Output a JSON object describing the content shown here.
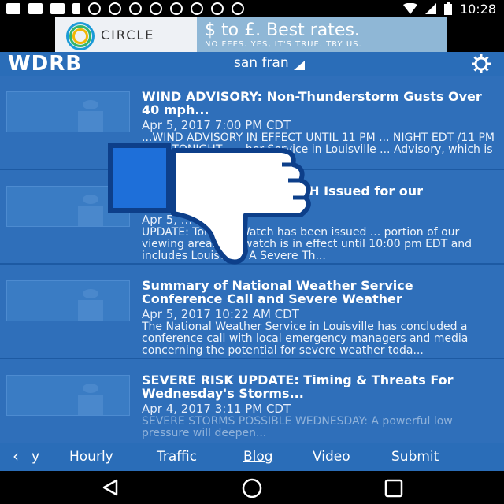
{
  "status_bar": {
    "time": "10:28"
  },
  "ad": {
    "brand": "CIRCLE",
    "headline": "$ to £. Best rates.",
    "subline": "NO FEES. YES, IT'S TRUE. TRY US."
  },
  "header": {
    "logo": "WDRB",
    "location": "san fran"
  },
  "articles": [
    {
      "title": "WIND ADVISORY: Non-Thunderstorm Gusts Over 40 mph...",
      "date": "Apr 5, 2017 7:00 PM CDT",
      "snippet": "...WIND ADVISORY IN EFFECT UNTIL 11 PM ... NIGHT EDT /11 PM CDT/ TONIGHT... ...her Service in Louisville ... Advisory, which is in e..."
    },
    {
      "title": "... and SEVERE ... WATCH Issued for our",
      "date": "Apr 5, ... CDT",
      "snippet": "UPDATE: Tornado Watch has been issued ... portion of our viewing area. The watch is in effect until 10:00 pm EDT and includes Louisville. A Severe Th..."
    },
    {
      "title": "Summary of National Weather Service Conference Call and Severe Weather",
      "date": "Apr 5, 2017 10:22 AM CDT",
      "snippet": "The National Weather Service in Louisville has concluded a conference call with local emergency managers and media concerning the potential for severe weather toda..."
    },
    {
      "title": "SEVERE RISK UPDATE: Timing & Threats For Wednesday's Storms...",
      "date": "Apr 4, 2017 3:11 PM CDT",
      "snippet": "SEVERE STORMS POSSIBLE WEDNESDAY: A powerful low pressure will deepen..."
    }
  ],
  "tabs": [
    "y",
    "Hourly",
    "Traffic",
    "Blog",
    "Video",
    "Submit"
  ],
  "active_tab": "Blog",
  "colors": {
    "app_blue": "#2a6db8",
    "background": "#1565c0",
    "thumb_down": "#1e6fd9"
  }
}
